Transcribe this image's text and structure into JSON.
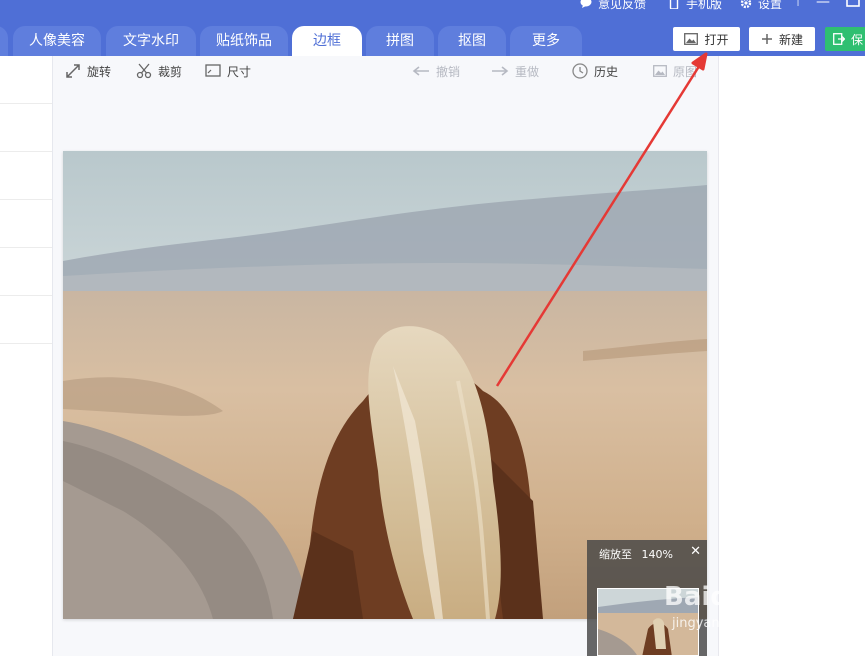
{
  "topbar": {
    "feedback_label": "意见反馈",
    "mobile_label": "手机版",
    "settings_label": "设置"
  },
  "tabs": [
    {
      "label": "人像美容",
      "active": false
    },
    {
      "label": "文字水印",
      "active": false
    },
    {
      "label": "贴纸饰品",
      "active": false
    },
    {
      "label": "边框",
      "active": true
    },
    {
      "label": "拼图",
      "active": false
    },
    {
      "label": "抠图",
      "active": false
    },
    {
      "label": "更多",
      "active": false
    }
  ],
  "actions": {
    "open_label": "打开",
    "new_label": "新建",
    "save_label": "保"
  },
  "toolbar": {
    "rotate_label": "旋转",
    "crop_label": "裁剪",
    "size_label": "尺寸",
    "undo_label": "撤销",
    "redo_label": "重做",
    "history_label": "历史",
    "original_label": "原图"
  },
  "zoom": {
    "label": "缩放至",
    "value": "140%"
  },
  "watermark": {
    "brand": "Baidu经验",
    "url": "jingyan.baidu.com"
  },
  "colors": {
    "titlebar": "#4f6fd6",
    "save_button": "#2fbf71",
    "annotation_arrow": "#e53935"
  }
}
